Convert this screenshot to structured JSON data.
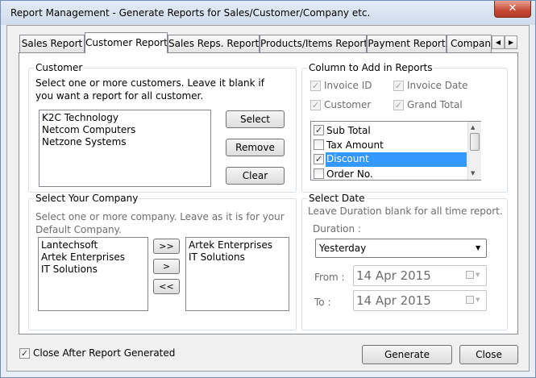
{
  "window": {
    "title": "Report Management - Generate Reports for Sales/Customer/Company etc.",
    "close_glyph": "✕"
  },
  "tabs": [
    {
      "label": "Sales Report"
    },
    {
      "label": "Customer Report"
    },
    {
      "label": "Sales Reps. Report"
    },
    {
      "label": "Products/Items Report"
    },
    {
      "label": "Payment Report"
    },
    {
      "label": "Company"
    }
  ],
  "tab_scroll": {
    "left": "◀",
    "right": "▶"
  },
  "customer": {
    "title": "Customer",
    "hint_line1": "Select one or more customers. Leave it blank if",
    "hint_line2": "you want a report for all customer.",
    "items": [
      "K2C Technology",
      "Netcom Computers",
      "Netzone Systems"
    ],
    "select_label": "Select",
    "remove_label": "Remove",
    "clear_label": "Clear"
  },
  "columns": {
    "title": "Column to Add in Reports",
    "fixed": [
      {
        "label": "Invoice ID"
      },
      {
        "label": "Invoice Date"
      },
      {
        "label": "Customer"
      },
      {
        "label": "Grand Total"
      }
    ],
    "list": [
      {
        "label": "Sub Total",
        "checked": true
      },
      {
        "label": "Tax Amount",
        "checked": false
      },
      {
        "label": "Discount",
        "checked": true,
        "selected": true
      },
      {
        "label": "Order No.",
        "checked": false
      }
    ],
    "check_glyph": "✓"
  },
  "company": {
    "title": "Select Your Company",
    "hint_line1": "Select one or more company. Leave as it is for your",
    "hint_line2": "Default Company.",
    "available": [
      "Lantechsoft",
      "Artek Enterprises",
      "IT Solutions"
    ],
    "selected": [
      "Artek Enterprises",
      "IT Solutions"
    ],
    "add_all_label": ">>",
    "add_label": ">",
    "remove_all_label": "<<"
  },
  "date": {
    "title": "Select Date",
    "hint": "Leave Duration blank for all time report.",
    "duration_label": "Duration :",
    "duration_value": "Yesterday",
    "from_label": "From :",
    "from_value": "14 Apr 2015",
    "to_label": "To :",
    "to_value": "14 Apr 2015"
  },
  "footer": {
    "close_after_label": "Close After Report Generated",
    "close_after_checked": true,
    "generate_label": "Generate",
    "close_label": "Close"
  },
  "colors": {
    "selection": "#3399ff",
    "title_gradient_top": "#e3ecf7",
    "close_red": "#c44a36"
  }
}
